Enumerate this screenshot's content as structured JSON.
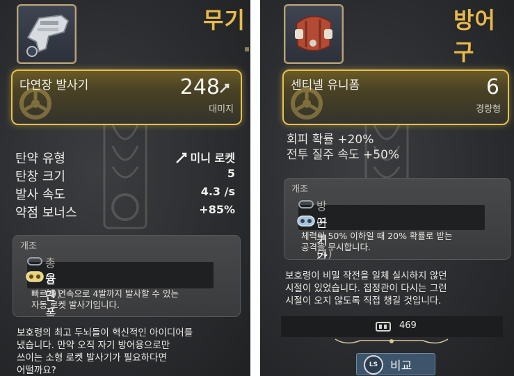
{
  "weapon_panel": {
    "tab_title": "무기",
    "item_name": "다연장 발사기",
    "damage_value": "248",
    "damage_label": "대미지",
    "stats": [
      {
        "label": "탄약 유형",
        "value": "미니 로켓"
      },
      {
        "label": "탄창 크기",
        "value": "5"
      },
      {
        "label": "발사 속도",
        "value": "4.3 /s"
      },
      {
        "label": "약점 보너스",
        "value": "+85%"
      }
    ],
    "mods_header": "개조",
    "mod_slot": "총열 (0)",
    "mod_name": "융단폭격",
    "mod_desc_1": "빠르게 연속으로 4발까지 발사할 수 있는",
    "mod_desc_2": "자동 로켓 발사기입니다.",
    "lore_1": "보호령의 최고 두뇌들이 혁신적인 아이디어를",
    "lore_2": "냈습니다. 만약 오직 자기 방어용으로만",
    "lore_3": "쓰이는 소형 로켓 발사기가 필요하다면",
    "lore_4": "어떨까요?"
  },
  "armor_panel": {
    "tab_title": "방어구",
    "item_name": "센티넬 유니폼",
    "weight_value": "6",
    "weight_label": "경량형",
    "perk_1": "회피 확률 +20%",
    "perk_2": "전투 질주 속도 +50%",
    "mods_header": "개조",
    "mod_slot": "방어구 (4)",
    "mod_name": "끈기 강화 재료",
    "mod_desc_1": "체력이 50% 이하일 때 20% 확률로 받는",
    "mod_desc_2": "공격을 무시합니다.",
    "lore_1": "보호령이 비밀 작전을 일체 실시하지 않던",
    "lore_2": "시절이 있었습니다. 집정관이 다시는 그런",
    "lore_3": "시절이 오지 않도록 직접 챙길 것입니다.",
    "price": "469",
    "compare_badge": "LS",
    "compare_label": "비교"
  },
  "colors": {
    "accent_gold": "#e6c24c",
    "tab_title": "#e9b94a",
    "button_blue": "#3d546b"
  }
}
